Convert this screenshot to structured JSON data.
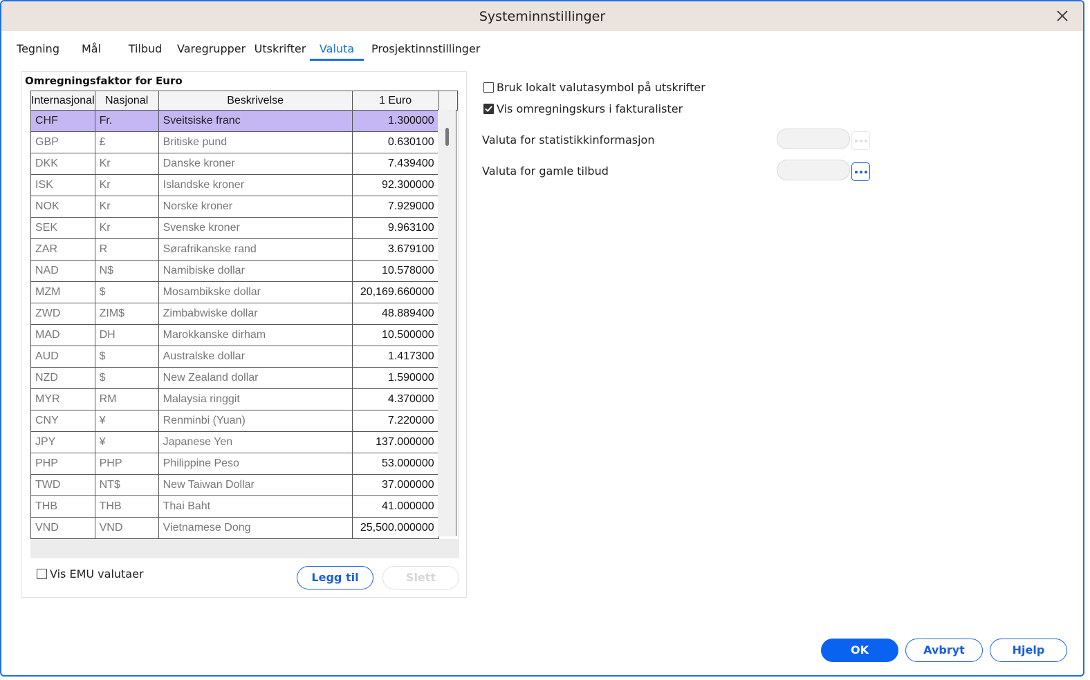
{
  "window": {
    "title": "Systeminnstillinger"
  },
  "tabs": [
    {
      "label": "Tegning",
      "active": false
    },
    {
      "label": "Mål",
      "active": false
    },
    {
      "label": "Tilbud",
      "active": false
    },
    {
      "label": "Varegrupper",
      "active": false
    },
    {
      "label": "Utskrifter",
      "active": false
    },
    {
      "label": "Valuta",
      "active": true
    },
    {
      "label": "Prosjektinnstillinger",
      "active": false
    }
  ],
  "currency_group": {
    "title": "Omregningsfaktor for Euro",
    "columns": [
      "Internasjonal",
      "Nasjonal",
      "Beskrivelse",
      "1 Euro"
    ],
    "rows": [
      {
        "int": "CHF",
        "nat": "Fr.",
        "desc": "Sveitsiske franc",
        "rate": "1.300000"
      },
      {
        "int": "GBP",
        "nat": "£",
        "desc": "Britiske pund",
        "rate": "0.630100"
      },
      {
        "int": "DKK",
        "nat": "Kr",
        "desc": "Danske kroner",
        "rate": "7.439400"
      },
      {
        "int": "ISK",
        "nat": "Kr",
        "desc": "Islandske kroner",
        "rate": "92.300000"
      },
      {
        "int": "NOK",
        "nat": "Kr",
        "desc": "Norske kroner",
        "rate": "7.929000"
      },
      {
        "int": "SEK",
        "nat": "Kr",
        "desc": "Svenske kroner",
        "rate": "9.963100"
      },
      {
        "int": "ZAR",
        "nat": "R",
        "desc": "Sørafrikanske rand",
        "rate": "3.679100"
      },
      {
        "int": "NAD",
        "nat": "N$",
        "desc": "Namibiske dollar",
        "rate": "10.578000"
      },
      {
        "int": "MZM",
        "nat": "$",
        "desc": "Mosambikske dollar",
        "rate": "20,169.660000"
      },
      {
        "int": "ZWD",
        "nat": "ZIM$",
        "desc": "Zimbabwiske dollar",
        "rate": "48.889400"
      },
      {
        "int": "MAD",
        "nat": "DH",
        "desc": "Marokkanske dirham",
        "rate": "10.500000"
      },
      {
        "int": "AUD",
        "nat": "$",
        "desc": "Australske dollar",
        "rate": "1.417300"
      },
      {
        "int": "NZD",
        "nat": "$",
        "desc": "New Zealand dollar",
        "rate": "1.590000"
      },
      {
        "int": "MYR",
        "nat": "RM",
        "desc": "Malaysia ringgit",
        "rate": "4.370000"
      },
      {
        "int": "CNY",
        "nat": "¥",
        "desc": "Renminbi (Yuan)",
        "rate": "7.220000"
      },
      {
        "int": "JPY",
        "nat": "¥",
        "desc": "Japanese Yen",
        "rate": "137.000000"
      },
      {
        "int": "PHP",
        "nat": "PHP",
        "desc": "Philippine Peso",
        "rate": "53.000000"
      },
      {
        "int": "TWD",
        "nat": "NT$",
        "desc": "New Taiwan Dollar",
        "rate": "37.000000"
      },
      {
        "int": "THB",
        "nat": "THB",
        "desc": "Thai Baht",
        "rate": "41.000000"
      },
      {
        "int": "VND",
        "nat": "VND",
        "desc": "Vietnamese Dong",
        "rate": "25,500.000000"
      }
    ],
    "show_emu_label": "Vis EMU valutaer",
    "add_label": "Legg til",
    "delete_label": "Slett"
  },
  "options": {
    "local_symbol_label": "Bruk lokalt valutasymbol på utskrifter",
    "local_symbol_checked": false,
    "show_rate_label": "Vis omregningskurs i fakturalister",
    "show_rate_checked": true,
    "stats_currency_label": "Valuta for statistikkinformasjon",
    "stats_currency_value": "",
    "old_quotes_currency_label": "Valuta for gamle tilbud",
    "old_quotes_currency_value": ""
  },
  "footer": {
    "ok_label": "OK",
    "cancel_label": "Avbryt",
    "help_label": "Hjelp"
  },
  "colors": {
    "accent": "#0a63f0",
    "selected_row": "#c5b7f4",
    "titlebar": "#ebe3dd"
  },
  "icons": {
    "close": "close-icon",
    "checkmark": "checkmark-icon",
    "ellipsis": "ellipsis-icon"
  }
}
